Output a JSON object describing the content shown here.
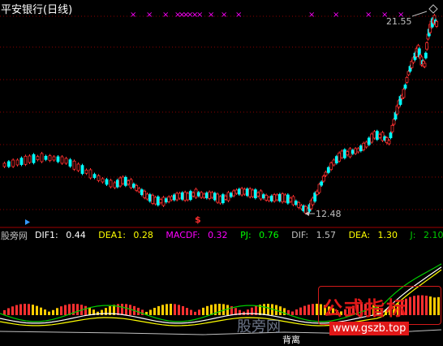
{
  "title": "平安银行(日线)",
  "price_labels": {
    "high": "21.55",
    "low": "12.48"
  },
  "signal_mark": "$",
  "indicator": {
    "name": "股旁网",
    "items": [
      {
        "label": "DIF1:",
        "value": "0.44",
        "color": "#ffffff"
      },
      {
        "label": "DEA1:",
        "value": "0.28",
        "color": "#ffff00"
      },
      {
        "label": "MACDF:",
        "value": "0.32",
        "color": "#ff00ff"
      },
      {
        "label": "PJ:",
        "value": "0.76",
        "color": "#00ff00"
      },
      {
        "label": "DIF:",
        "value": "1.57",
        "color": "#c0c0c0"
      },
      {
        "label": "DEA:",
        "value": "1.30",
        "color": "#ffff00"
      },
      {
        "label": "J:",
        "value": "2.10",
        "color": "#00cc00"
      }
    ]
  },
  "watermark": {
    "text": "股旁网",
    "url": "www.gszb.top",
    "logo": "公式指标",
    "bottom_text": "背离"
  },
  "colors": {
    "up": "#ff3030",
    "down": "#00ffff",
    "grid": "#8b0000",
    "marker": "#ff00ff"
  }
}
